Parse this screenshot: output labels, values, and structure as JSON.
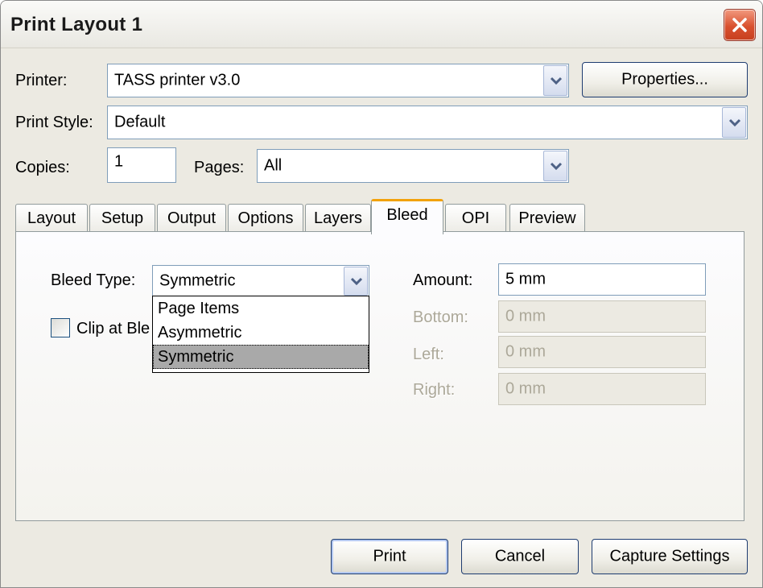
{
  "window": {
    "title": "Print Layout 1"
  },
  "printer": {
    "label": "Printer:",
    "value": "TASS printer v3.0",
    "properties_label": "Properties..."
  },
  "print_style": {
    "label": "Print Style:",
    "value": "Default"
  },
  "copies": {
    "label": "Copies:",
    "value": "1"
  },
  "pages": {
    "label": "Pages:",
    "value": "All"
  },
  "tabs": [
    {
      "label": "Layout"
    },
    {
      "label": "Setup"
    },
    {
      "label": "Output"
    },
    {
      "label": "Options"
    },
    {
      "label": "Layers"
    },
    {
      "label": "Bleed"
    },
    {
      "label": "OPI"
    },
    {
      "label": "Preview"
    }
  ],
  "active_tab": "Bleed",
  "bleed": {
    "type_label": "Bleed Type:",
    "type_value": "Symmetric",
    "options": [
      "Page Items",
      "Asymmetric",
      "Symmetric"
    ],
    "selected_option": "Symmetric",
    "clip_label": "Clip at Ble",
    "clip_checked": false,
    "amount_label": "Amount:",
    "amount_value": "5 mm",
    "bottom_label": "Bottom:",
    "bottom_value": "0 mm",
    "left_label": "Left:",
    "left_value": "0 mm",
    "right_label": "Right:",
    "right_value": "0 mm"
  },
  "buttons": {
    "print": "Print",
    "cancel": "Cancel",
    "capture": "Capture Settings"
  },
  "colors": {
    "dialog_bg": "#eceae2",
    "close_button": "#d9512f",
    "active_tab_accent": "#f2a20c",
    "field_border": "#7f9db9"
  }
}
